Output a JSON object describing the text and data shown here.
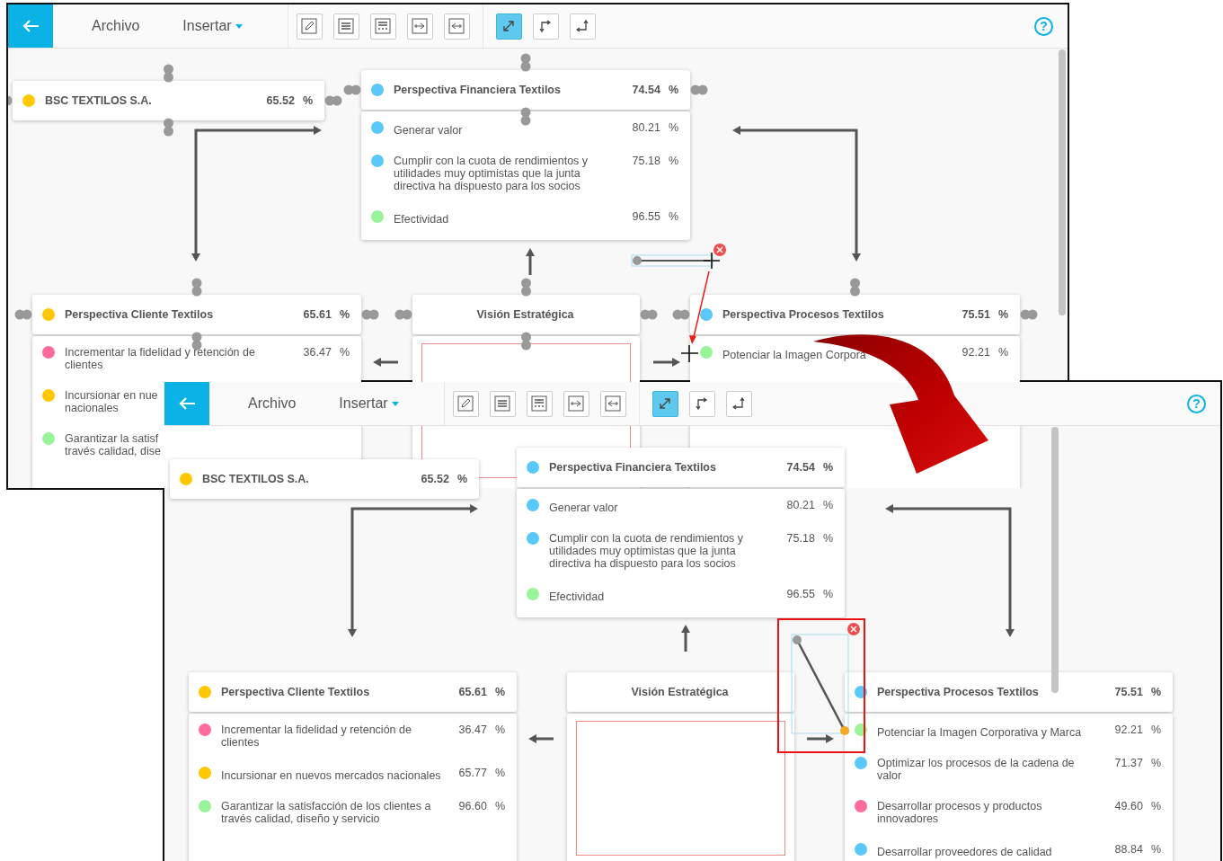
{
  "screenshots": [
    {
      "toolbar": {
        "menus": [
          {
            "label": "Archivo",
            "dropdown": false
          },
          {
            "label": "Insertar",
            "dropdown": true
          }
        ],
        "connector_tools": [
          {
            "selected": true
          },
          {
            "selected": false
          },
          {
            "selected": false
          }
        ],
        "help": "?"
      },
      "show_handles": true,
      "company": {
        "name": "BSC TEXTILOS S.A.",
        "value": "65.52",
        "unit": "%",
        "color": "#ffc800"
      },
      "perspectives": [
        {
          "title": "Perspectiva Financiera Textilos",
          "value": "74.54",
          "unit": "%",
          "color": "#5bc8fb",
          "objectives": [
            {
              "text": "Generar valor",
              "value": "80.21",
              "unit": "%",
              "color": "#5bc8fb"
            },
            {
              "text": "Cumplir con la cuota de rendimientos y utilidades muy optimistas que la junta directiva ha dispuesto para los socios",
              "value": "75.18",
              "unit": "%",
              "color": "#5bc8fb"
            },
            {
              "text": "Efectividad",
              "value": "96.55",
              "unit": "%",
              "color": "#9af59a"
            }
          ]
        },
        {
          "title": "Perspectiva Cliente Textilos",
          "value": "65.61",
          "unit": "%",
          "color": "#ffc800",
          "objectives": [
            {
              "text": "Incrementar la fidelidad y retención de clientes",
              "value": "36.47",
              "unit": "%",
              "color": "#ff6b9a"
            },
            {
              "text": "Incursionar en nue\nnacionales",
              "color": "#ffc800"
            },
            {
              "text": "Garantizar la satisf\ntravés calidad, dise",
              "color": "#9af59a"
            }
          ]
        },
        {
          "title": "Perspectiva Procesos Textilos",
          "value": "75.51",
          "unit": "%",
          "color": "#5bc8fb",
          "objectives": [
            {
              "text": "Potenciar la Imagen Corpora",
              "value": "92.21",
              "unit": "%",
              "color": "#9af59a"
            }
          ]
        }
      ],
      "vision": {
        "title": "Visión Estratégica"
      },
      "connector": {
        "kind": "draft"
      }
    },
    {
      "toolbar": {
        "menus": [
          {
            "label": "Archivo",
            "dropdown": false
          },
          {
            "label": "Insertar",
            "dropdown": true
          }
        ],
        "connector_tools": [
          {
            "selected": true
          },
          {
            "selected": false
          },
          {
            "selected": false
          }
        ],
        "help": "?"
      },
      "show_handles": false,
      "company": {
        "name": "BSC TEXTILOS S.A.",
        "value": "65.52",
        "unit": "%",
        "color": "#ffc800"
      },
      "perspectives": [
        {
          "title": "Perspectiva Financiera Textilos",
          "value": "74.54",
          "unit": "%",
          "color": "#5bc8fb",
          "objectives": [
            {
              "text": "Generar valor",
              "value": "80.21",
              "unit": "%",
              "color": "#5bc8fb"
            },
            {
              "text": "Cumplir con la cuota de rendimientos y utilidades muy optimistas que la junta directiva ha dispuesto para los socios",
              "value": "75.18",
              "unit": "%",
              "color": "#5bc8fb"
            },
            {
              "text": "Efectividad",
              "value": "96.55",
              "unit": "%",
              "color": "#9af59a"
            }
          ]
        },
        {
          "title": "Perspectiva Cliente Textilos",
          "value": "65.61",
          "unit": "%",
          "color": "#ffc800",
          "objectives": [
            {
              "text": "Incrementar la fidelidad y retención de clientes",
              "value": "36.47",
              "unit": "%",
              "color": "#ff6b9a"
            },
            {
              "text": "Incursionar en nuevos mercados nacionales",
              "value": "65.77",
              "unit": "%",
              "color": "#ffc800"
            },
            {
              "text": "Garantizar la satisfacción de los clientes a través calidad, diseño y servicio",
              "value": "96.60",
              "unit": "%",
              "color": "#9af59a"
            }
          ]
        },
        {
          "title": "Perspectiva Procesos Textilos",
          "value": "75.51",
          "unit": "%",
          "color": "#5bc8fb",
          "objectives": [
            {
              "text": "Potenciar la Imagen Corporativa y Marca",
              "value": "92.21",
              "unit": "%",
              "color": "#9af59a"
            },
            {
              "text": "Optimizar los procesos de la cadena de valor",
              "value": "71.37",
              "unit": "%",
              "color": "#5bc8fb"
            },
            {
              "text": "Desarrollar procesos y productos innovadores",
              "value": "49.60",
              "unit": "%",
              "color": "#ff6b9a"
            },
            {
              "text": "Desarrollar proveedores de calidad",
              "value": "88.84",
              "unit": "%",
              "color": "#5bc8fb"
            }
          ]
        }
      ],
      "vision": {
        "title": "Visión Estratégica"
      },
      "connector": {
        "kind": "selected"
      }
    }
  ]
}
